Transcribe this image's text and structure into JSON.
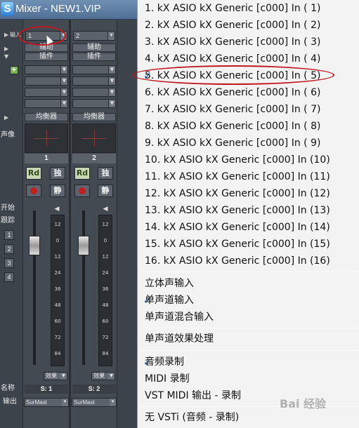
{
  "window": {
    "title": "Mixer - NEW1.VIP",
    "app_icon": "S"
  },
  "mixer": {
    "side_labels": {
      "input": "输入",
      "pan": "声像",
      "start": "开始",
      "track": "跟踪",
      "name": "名称",
      "output": "输出"
    },
    "side_numbers": [
      "1",
      "2",
      "3",
      "4"
    ],
    "channels": [
      {
        "number": "1",
        "input_value": "1",
        "aux_label": "辅助",
        "plugin_label": "插件",
        "eq_label": "均衡器",
        "rd": "Rd",
        "solo": "独",
        "mute": "静",
        "scale": [
          "12",
          "0",
          "12",
          "24",
          "36",
          "48",
          "60",
          "72",
          "84"
        ],
        "fx_label": "效果",
        "strip_name": "S: 1",
        "output_value": "SurMast"
      },
      {
        "number": "2",
        "input_value": "2",
        "aux_label": "辅助",
        "plugin_label": "插件",
        "eq_label": "均衡器",
        "rd": "Rd",
        "solo": "独",
        "mute": "静",
        "scale": [
          "12",
          "0",
          "12",
          "24",
          "36",
          "48",
          "60",
          "72",
          "84"
        ],
        "fx_label": "效果",
        "strip_name": "S: 2",
        "output_value": "SurMast"
      }
    ]
  },
  "menu": {
    "inputs": [
      {
        "label": "1.  kX ASIO kX Generic [c000] In ( 1)",
        "checked": false
      },
      {
        "label": "2.  kX ASIO kX Generic [c000] In ( 2)",
        "checked": false
      },
      {
        "label": "3.  kX ASIO kX Generic [c000] In ( 3)",
        "checked": false
      },
      {
        "label": "4.  kX ASIO kX Generic [c000] In ( 4)",
        "checked": false
      },
      {
        "label": "5.  kX ASIO kX Generic [c000] In ( 5)",
        "checked": true
      },
      {
        "label": "6.  kX ASIO kX Generic [c000] In ( 6)",
        "checked": false
      },
      {
        "label": "7.  kX ASIO kX Generic [c000] In ( 7)",
        "checked": false
      },
      {
        "label": "8.  kX ASIO kX Generic [c000] In ( 8)",
        "checked": false
      },
      {
        "label": "9.  kX ASIO kX Generic [c000] In ( 9)",
        "checked": false
      },
      {
        "label": "10.  kX ASIO kX Generic [c000] In (10)",
        "checked": false
      },
      {
        "label": "11.  kX ASIO kX Generic [c000] In (11)",
        "checked": false
      },
      {
        "label": "12.  kX ASIO kX Generic [c000] In (12)",
        "checked": false
      },
      {
        "label": "13.  kX ASIO kX Generic [c000] In (13)",
        "checked": false
      },
      {
        "label": "14.  kX ASIO kX Generic [c000] In (14)",
        "checked": false
      },
      {
        "label": "15.  kX ASIO kX Generic [c000] In (15)",
        "checked": false
      },
      {
        "label": "16.  kX ASIO kX Generic [c000] In (16)",
        "checked": false
      }
    ],
    "mode_group": [
      {
        "label": "立体声输入",
        "checked": false
      },
      {
        "label": "单声道输入",
        "checked": true
      },
      {
        "label": "单声道混合输入",
        "checked": false
      }
    ],
    "fx_item": {
      "label": "单声道效果处理",
      "checked": false
    },
    "record_group": [
      {
        "label": "音频录制",
        "checked": true
      },
      {
        "label": "MIDI 录制",
        "checked": false
      },
      {
        "label": "VST MIDI 输出 - 录制",
        "checked": false
      }
    ],
    "vsti_item": {
      "label": "无 VSTi (音频 - 录制)",
      "checked": false
    },
    "check_glyph": "✓"
  },
  "watermark": "Bai 经验",
  "colors": {
    "accent_check": "#1a5fb4",
    "annotation_red": "#c0181e"
  }
}
